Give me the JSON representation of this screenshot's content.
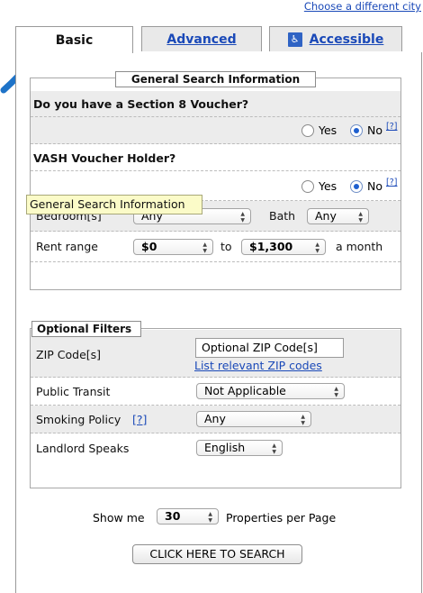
{
  "top_link": "Choose a different city",
  "tabs": {
    "basic": "Basic",
    "advanced": "Advanced",
    "accessible": "Accessible",
    "accessible_icon": "&"
  },
  "general": {
    "legend": "General Search Information",
    "section8_question": "Do you have a Section 8 Voucher?",
    "vash_question": "VASH Voucher Holder?",
    "yes": "Yes",
    "no": "No",
    "help": "[?]",
    "section8_selected": "No",
    "vash_selected": "No",
    "bedrooms_label": "Bedroom[s]",
    "bedrooms_value": "Any",
    "bath_label": "Bath",
    "bath_value": "Any",
    "rent_label": "Rent range",
    "rent_min": "$0",
    "rent_to": "to",
    "rent_max": "$1,300",
    "rent_suffix": "a month"
  },
  "tooltip": "General Search Information",
  "optional": {
    "legend": "Optional Filters",
    "zip_label": "ZIP Code[s]",
    "zip_placeholder": "Optional ZIP Code[s]",
    "zip_link": "List relevant ZIP codes",
    "transit_label": "Public Transit",
    "transit_value": "Not Applicable",
    "smoking_label": "Smoking Policy",
    "smoking_help": "[?]",
    "smoking_value": "Any",
    "landlord_label": "Landlord Speaks",
    "landlord_value": "English"
  },
  "results": {
    "show_me": "Show me",
    "per_page_value": "30",
    "per_page_suffix": "Properties per Page"
  },
  "search_button": "CLICK HERE TO SEARCH",
  "colors": {
    "link": "#1a49b8",
    "arrow": "#1e73c8",
    "grey_row": "#ececec",
    "tooltip_bg": "#fbfbc8",
    "radio_selected": "#1e5fcf"
  },
  "icons": {
    "pointer_arrow": "arrow-icon",
    "select_arrows": "updown-arrows-icon"
  }
}
